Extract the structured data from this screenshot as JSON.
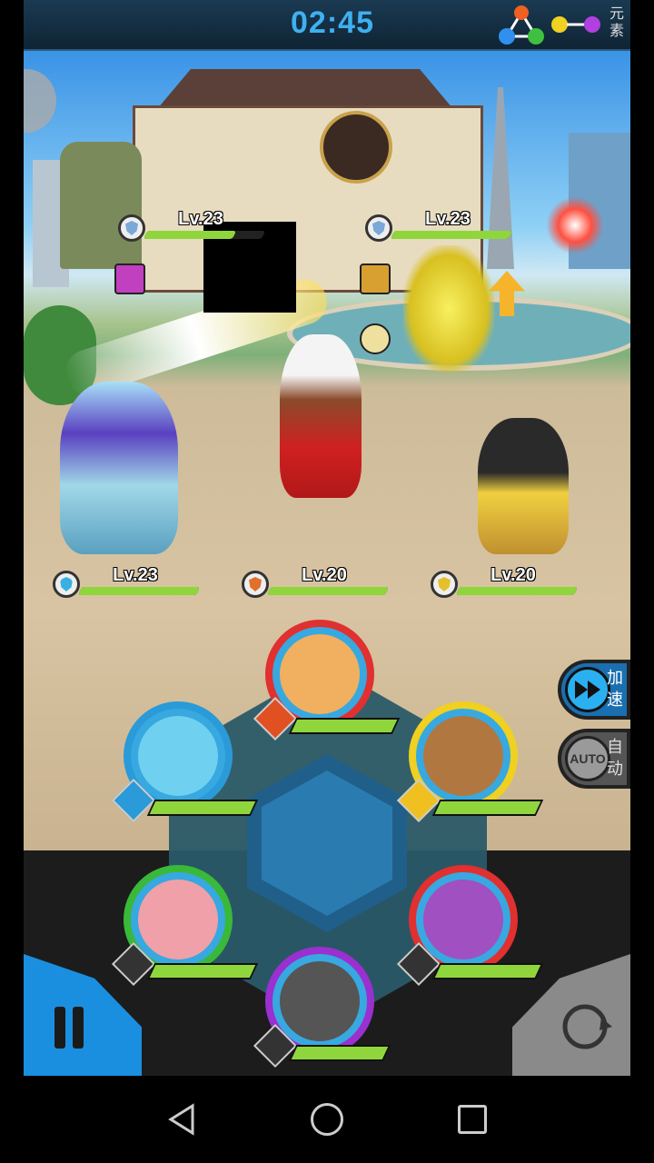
{
  "hud": {
    "timer": "02:45",
    "element_label": "元素",
    "elements_icon": "element-triangle-icon",
    "key_icon": "element-key-icon"
  },
  "enemies": [
    {
      "level": "Lv.23",
      "shield_color": "#7aa8d8",
      "hp_fraction": 0.75
    },
    {
      "level": "Lv.23",
      "shield_color": "#7aa8d8",
      "hp_fraction": 1.0
    }
  ],
  "allies": [
    {
      "level": "Lv.23",
      "shield_color": "#3ab0e0",
      "hp_fraction": 1.0
    },
    {
      "level": "Lv.20",
      "shield_color": "#e0702a",
      "hp_fraction": 1.0
    },
    {
      "level": "Lv.20",
      "shield_color": "#e6c02a",
      "hp_fraction": 1.0
    }
  ],
  "buttons": {
    "speed_label": "加速",
    "auto_label": "自动",
    "auto_text": "AUTO"
  },
  "portraits": [
    {
      "name": "monkey-king",
      "ring_color": "#e03030",
      "face_color": "#f0b060",
      "hp_fraction": 1.0
    },
    {
      "name": "ice-princess",
      "ring_color": "#2a9ad8",
      "face_color": "#6fd0f0",
      "hp_fraction": 1.0
    },
    {
      "name": "bear-cannon",
      "ring_color": "#f0d020",
      "face_color": "#b07840",
      "hp_fraction": 1.0
    },
    {
      "name": "pig-warrior",
      "ring_color": "#3ab83a",
      "face_color": "#f0a0a8",
      "hp_fraction": 1.0
    },
    {
      "name": "red-demon",
      "ring_color": "#e03030",
      "face_color": "#a050c0",
      "hp_fraction": 1.0
    },
    {
      "name": "cat-hat",
      "ring_color": "#9a30d0",
      "face_color": "#555555",
      "hp_fraction": 1.0
    }
  ],
  "colors": {
    "accent_blue": "#1a8fe0",
    "hp_green": "#8fd63c"
  }
}
